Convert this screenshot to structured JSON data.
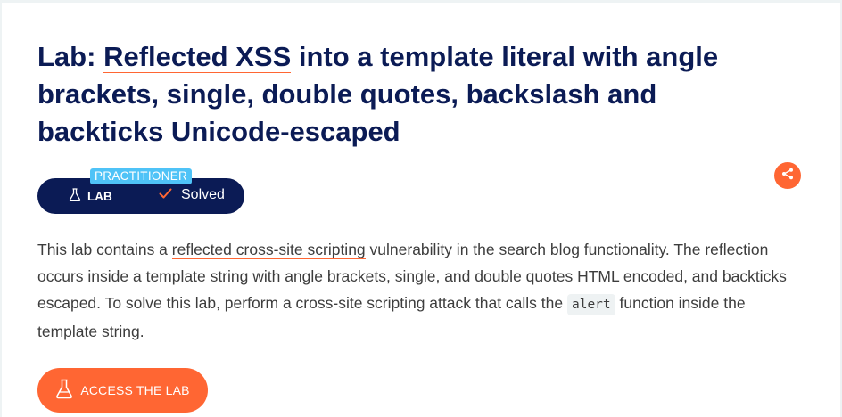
{
  "lab": {
    "title_prefix": "Lab: ",
    "title_link": "Reflected XSS",
    "title_suffix": " into a template literal with angle brackets, single, double quotes, backslash and backticks Unicode-escaped"
  },
  "status": {
    "level": "PRACTITIONER",
    "lab_label": "LAB",
    "solved_label": "Solved"
  },
  "description": {
    "part1": "This lab contains a ",
    "link": "reflected cross-site scripting",
    "part2": " vulnerability in the search blog functionality. The reflection occurs inside a template string with angle brackets, single, and double quotes HTML encoded, and backticks escaped. To solve this lab, perform a cross-site scripting attack that calls the ",
    "code": "alert",
    "part3": " function inside the template string."
  },
  "actions": {
    "access_label": "ACCESS THE LAB"
  },
  "colors": {
    "brand_navy": "#0b1b55",
    "accent_orange": "#ff6633",
    "level_blue": "#4fc3f7"
  },
  "icons": {
    "flask": "flask-icon",
    "check": "check-icon",
    "share": "share-icon"
  }
}
